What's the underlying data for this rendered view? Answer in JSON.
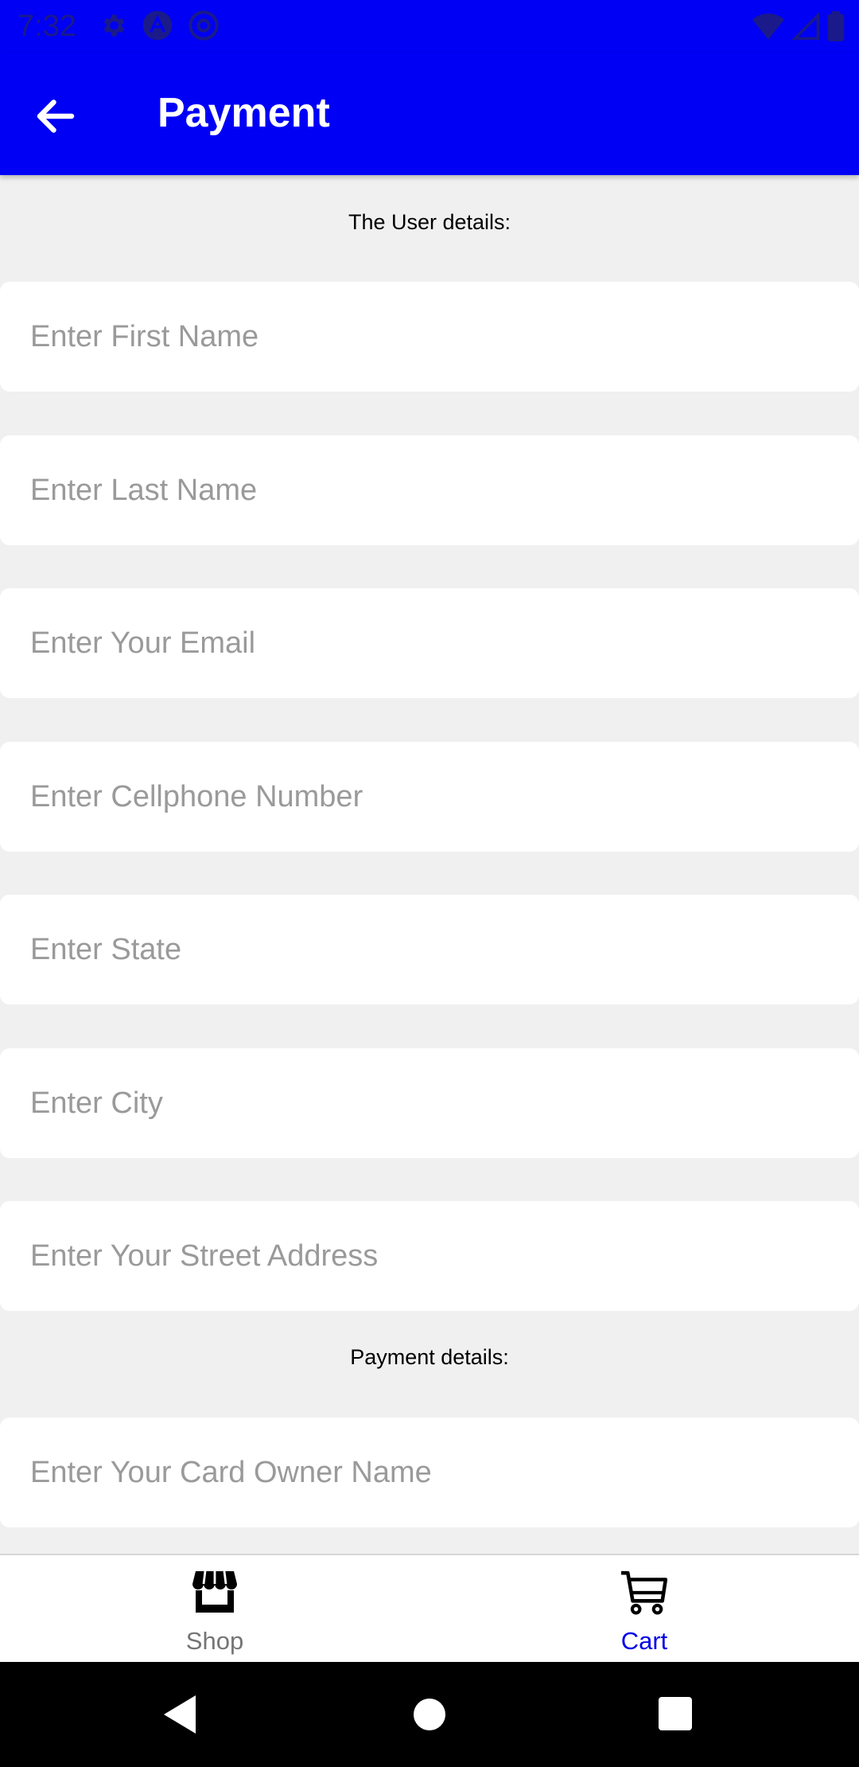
{
  "status_bar": {
    "time": "7:32"
  },
  "app_bar": {
    "title": "Payment"
  },
  "sections": {
    "user_details_label": "The User details:",
    "payment_details_label": "Payment details:"
  },
  "fields": {
    "first_name": {
      "placeholder": "Enter First Name",
      "value": ""
    },
    "last_name": {
      "placeholder": "Enter Last Name",
      "value": ""
    },
    "email": {
      "placeholder": "Enter Your Email",
      "value": ""
    },
    "cellphone": {
      "placeholder": "Enter Cellphone Number",
      "value": ""
    },
    "state": {
      "placeholder": "Enter State",
      "value": ""
    },
    "city": {
      "placeholder": "Enter City",
      "value": ""
    },
    "street": {
      "placeholder": "Enter Your Street Address",
      "value": ""
    },
    "card_owner": {
      "placeholder": "Enter Your Card Owner Name",
      "value": ""
    }
  },
  "bottom_nav": {
    "items": [
      {
        "label": "Shop",
        "icon": "store-icon",
        "active": false
      },
      {
        "label": "Cart",
        "icon": "cart-icon",
        "active": true
      }
    ]
  },
  "colors": {
    "primary": "#0000f5",
    "nav_active": "#0000e6",
    "nav_inactive": "#757575",
    "placeholder": "#9a9a9a",
    "background": "#f0f0f0"
  }
}
